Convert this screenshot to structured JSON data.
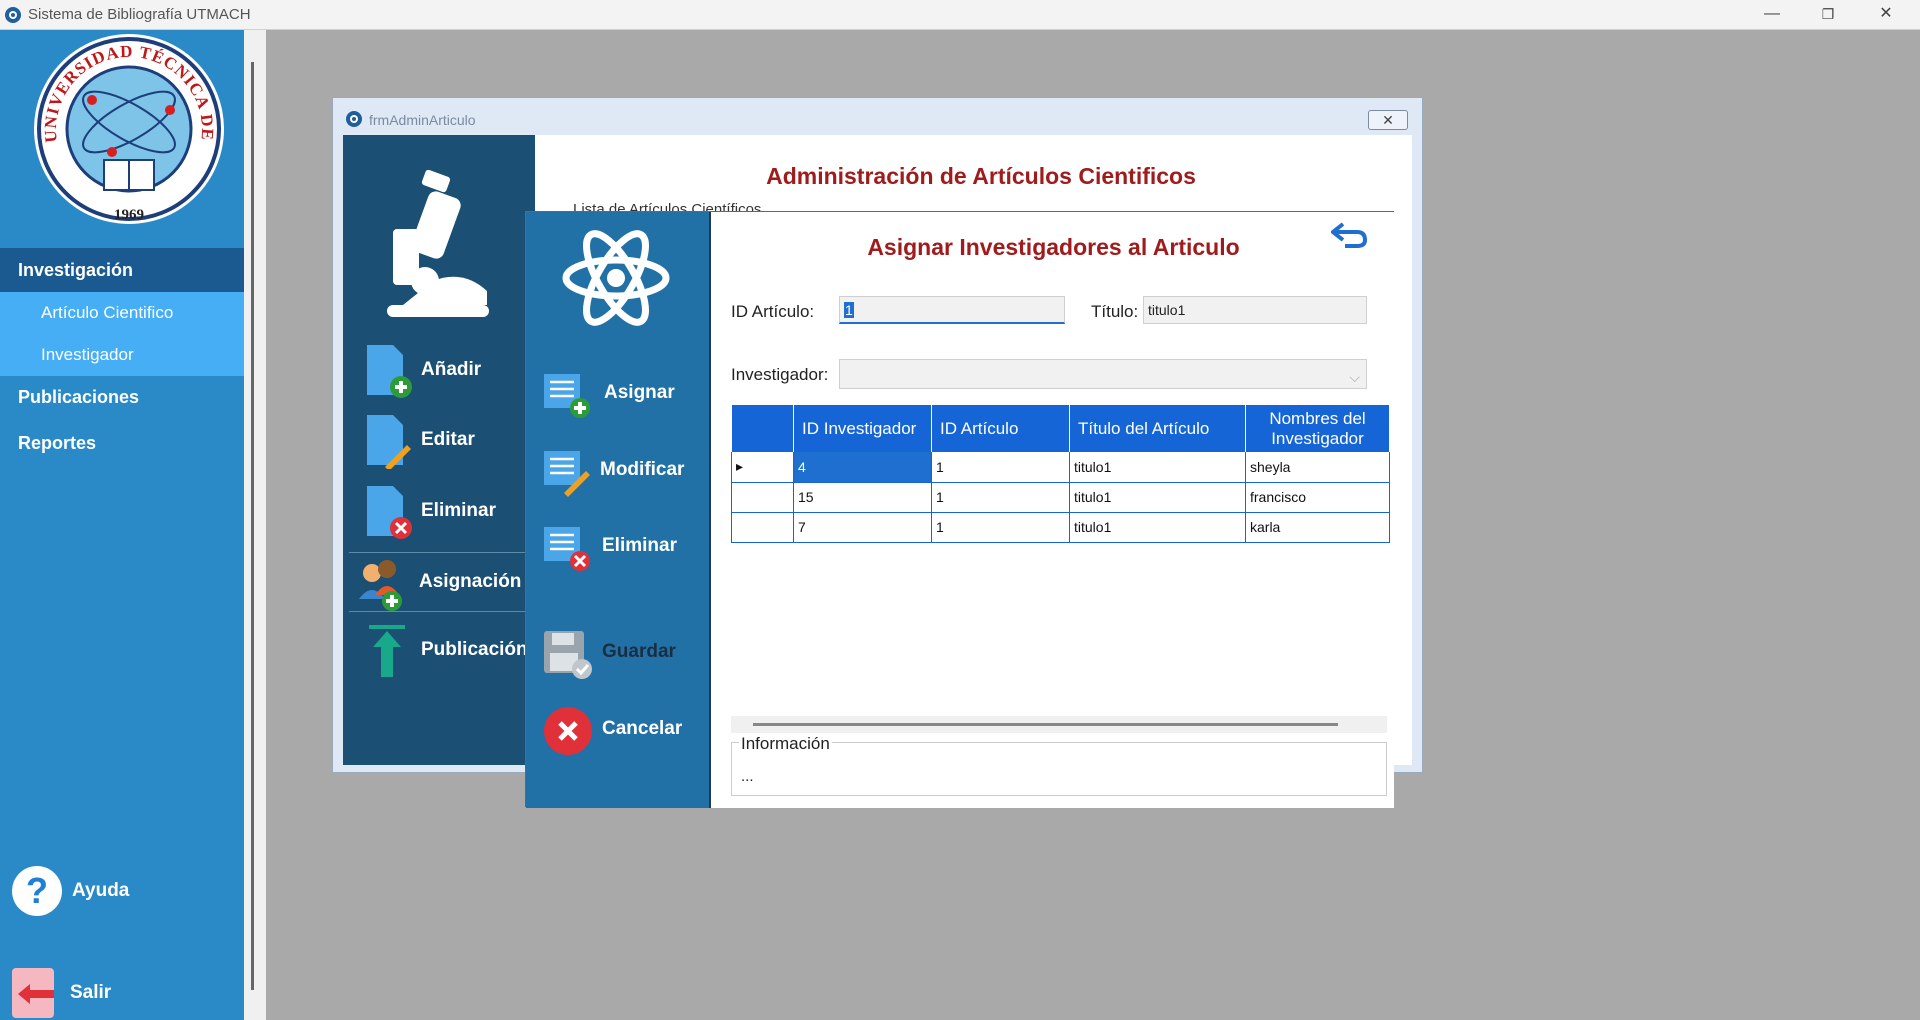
{
  "window": {
    "title": "Sistema de Bibliografía UTMACH",
    "minimize": "—",
    "restore": "❐",
    "close": "✕"
  },
  "sidebar": {
    "logo": {
      "arc_text": "UNIVERSIDAD TÉCNICA DE MACHALA",
      "year": "1969"
    },
    "sections": [
      {
        "label": "Investigación"
      },
      {
        "label": "Publicaciones"
      },
      {
        "label": "Reportes"
      }
    ],
    "subitems": [
      {
        "label": "Artículo Cientifico"
      },
      {
        "label": "Investigador"
      }
    ],
    "ayuda": {
      "label": "Ayuda",
      "icon": "question-icon"
    },
    "salir": {
      "label": "Salir",
      "icon": "exit-arrow-icon"
    }
  },
  "bg_window": {
    "title": "frmAdminArticulo",
    "close": "✕",
    "heading": "Administración de Artículos Cientificos",
    "list_label": "Lista de Artículos Científicos",
    "buttons": [
      {
        "label": "Añadir",
        "icon": "add-document-icon"
      },
      {
        "label": "Editar",
        "icon": "edit-document-icon"
      },
      {
        "label": "Eliminar",
        "icon": "delete-document-icon"
      },
      {
        "label": "Asignación",
        "icon": "assign-users-icon"
      },
      {
        "label": "Publicación",
        "icon": "upload-arrow-icon"
      }
    ]
  },
  "dialog": {
    "heading": "Asignar Investigadores al Articulo",
    "fields": {
      "id_label": "ID Artículo:",
      "id_value": "1",
      "title_label": "Título:",
      "title_value": "titulo1",
      "investigator_label": "Investigador:",
      "investigator_value": ""
    },
    "buttons": [
      {
        "label": "Asignar",
        "icon": "assign-list-icon"
      },
      {
        "label": "Modificar",
        "icon": "edit-list-icon"
      },
      {
        "label": "Eliminar",
        "icon": "delete-list-icon"
      },
      {
        "label": "Guardar",
        "icon": "save-disk-icon"
      },
      {
        "label": "Cancelar",
        "icon": "cancel-circle-icon"
      }
    ],
    "table": {
      "columns": [
        "ID Investigador",
        "ID Artículo",
        "Título del Artículo",
        "Nombres del Investigador"
      ],
      "rows": [
        [
          "4",
          "1",
          "titulo1",
          "sheyla"
        ],
        [
          "15",
          "1",
          "titulo1",
          "francisco"
        ],
        [
          "7",
          "1",
          "titulo1",
          "karla"
        ]
      ],
      "current_row_marker": "▸"
    },
    "info": {
      "legend": "Información",
      "text": "..."
    }
  },
  "colors": {
    "sidebar": "#2a8ac8",
    "sidebar_active": "#1a5a90",
    "sidebar_sub": "#46aef5",
    "dialog_left": "#2171a6",
    "bg_left": "#1b4f73",
    "heading_red": "#a01c1c",
    "grid_header": "#1565d6"
  }
}
